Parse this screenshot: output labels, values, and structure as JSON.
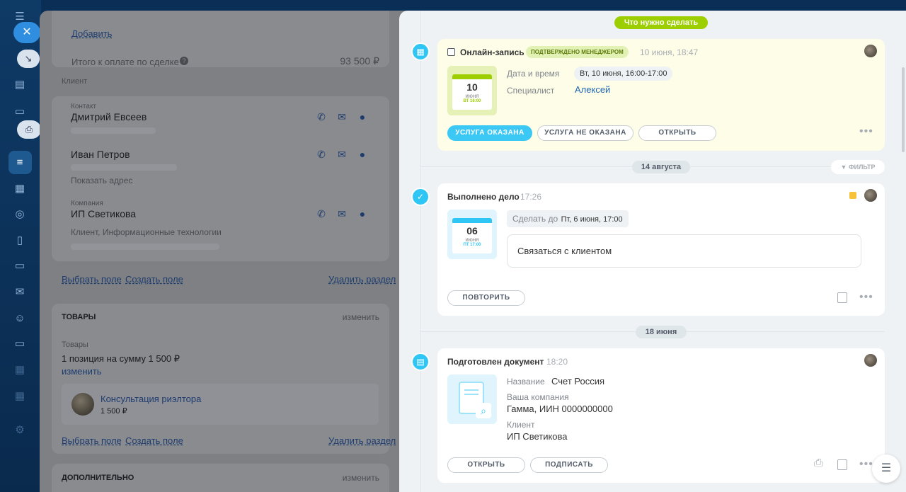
{
  "deal": {
    "add_link": "Добавить",
    "total_label": "Итого к оплате по сделке",
    "total_value": "93 500 ₽",
    "client_section": "Клиент",
    "contact_label": "Контакт",
    "contact1_name": "Дмитрий Евсеев",
    "contact2_name": "Иван Петров",
    "show_address": "Показать адрес",
    "company_label": "Компания",
    "company_name": "ИП Светикова",
    "company_desc": "Клиент, Информационные технологии",
    "select_field": "Выбрать поле",
    "create_field": "Создать поле",
    "delete_section": "Удалить раздел",
    "products_title": "ТОВАРЫ",
    "products_edit": "изменить",
    "products_label": "Товары",
    "products_summary": "1 позиция на сумму 1 500 ₽",
    "products_change": "изменить",
    "product_name": "Консультация риэлтора",
    "product_price": "1 500 ₽",
    "select_field2": "Выбрать поле",
    "create_field2": "Создать поле",
    "delete_section2": "Удалить раздел",
    "additional_title": "ДОПОЛНИТЕЛЬНО",
    "additional_edit": "изменить"
  },
  "timeline": {
    "todo_badge": "Что нужно сделать",
    "booking": {
      "title": "Онлайн-запись",
      "status": "ПОДТВЕРЖДЕНО МЕНЕДЖЕРОМ",
      "time": "10 июня, 18:47",
      "cal_day": "10",
      "cal_month": "июня",
      "cal_time": "ВТ 16:00",
      "datetime_label": "Дата и время",
      "datetime_value": "Вт, 10 июня, 16:00-17:00",
      "specialist_label": "Специалист",
      "specialist_value": "Алексей",
      "btn_done": "УСЛУГА ОКАЗАНА",
      "btn_not_done": "УСЛУГА НЕ ОКАЗАНА",
      "btn_open": "ОТКРЫТЬ"
    },
    "sep1": "14 августа",
    "filter": "ФИЛЬТР",
    "task": {
      "title": "Выполнено дело",
      "time": "17:26",
      "cal_day": "06",
      "cal_month": "июня",
      "cal_time": "ПТ 17:00",
      "deadline_label": "Сделать до",
      "deadline_value": "Пт, 6 июня, 17:00",
      "text": "Связаться с клиентом",
      "btn_repeat": "ПОВТОРИТЬ"
    },
    "sep2": "18 июня",
    "doc": {
      "title": "Подготовлен документ",
      "time": "18:20",
      "name_label": "Название",
      "name_value": "Счет Россия",
      "company_label": "Ваша компания",
      "company_value": "Гамма, ИИН 0000000000",
      "client_label": "Клиент",
      "client_value": "ИП Светикова",
      "btn_open": "ОТКРЫТЬ",
      "btn_sign": "ПОДПИСАТЬ"
    }
  },
  "colors": {
    "accent": "#3bc8f5",
    "green_badge": "#9dcf00",
    "yellow_card": "#fefde7",
    "overlay_panel": "#7f8084"
  }
}
